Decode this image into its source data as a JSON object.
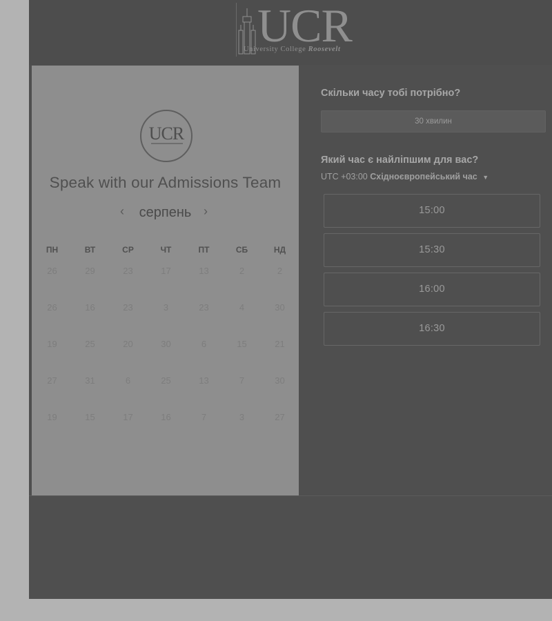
{
  "header": {
    "logo_text": "UCR",
    "logo_subtitle_a": "University College",
    "logo_subtitle_b": "Roosevelt"
  },
  "calendar": {
    "badge_text": "UCR",
    "title": "Speak with our Admissions Team",
    "month": "серпень",
    "prev_icon": "chevron-left-icon",
    "next_icon": "chevron-right-icon",
    "weekdays": [
      "ПН",
      "ВТ",
      "СР",
      "ЧТ",
      "ПТ",
      "СБ",
      "НД"
    ],
    "weeks": [
      [
        "26",
        "29",
        "23",
        "17",
        "13",
        "2",
        "2"
      ],
      [
        "26",
        "16",
        "23",
        "3",
        "23",
        "4",
        "30"
      ],
      [
        "19",
        "25",
        "20",
        "30",
        "6",
        "15",
        "21"
      ],
      [
        "27",
        "31",
        "6",
        "25",
        "13",
        "7",
        "30"
      ],
      [
        "19",
        "15",
        "17",
        "16",
        "7",
        "3",
        "27"
      ]
    ]
  },
  "booking": {
    "duration_question": "Скільки часу тобі потрібно?",
    "duration_value": "30 хвилин",
    "time_question": "Який час є найліпшим для вас?",
    "timezone_offset": "UTC +03:00",
    "timezone_name": "Східноєвропейський час",
    "slots": [
      "15:00",
      "15:30",
      "16:00",
      "16:30"
    ]
  },
  "colors": {
    "page_bg": "#b3b3b3",
    "frame_bg": "#4f4f4f",
    "calendar_bg": "#8e8e8e"
  }
}
